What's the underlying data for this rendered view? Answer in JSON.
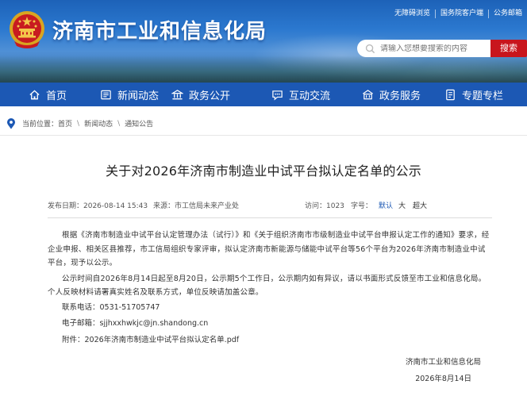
{
  "header": {
    "site_title": "济南市工业和信息化局",
    "top_links": [
      "无障碍浏览",
      "国务院客户端",
      "公务邮箱"
    ],
    "search": {
      "placeholder": "请输入您想要搜索的内容",
      "button_label": "搜索"
    },
    "colors": {
      "accent_blue": "#1c58b4",
      "search_red": "#c8151d"
    }
  },
  "nav": {
    "items": [
      {
        "label": "首页",
        "icon": "home-icon"
      },
      {
        "label": "新闻动态",
        "icon": "news-icon"
      },
      {
        "label": "政务公开",
        "icon": "building-icon"
      },
      {
        "label": "互动交流",
        "icon": "chat-icon"
      },
      {
        "label": "政务服务",
        "icon": "service-icon"
      },
      {
        "label": "专题专栏",
        "icon": "document-icon"
      }
    ]
  },
  "breadcrumb": {
    "prefix": "当前位置：",
    "items": [
      "首页",
      "新闻动态",
      "通知公告"
    ],
    "separator": "\\"
  },
  "article": {
    "title": "关于对2026年济南市制造业中试平台拟认定名单的公示",
    "meta": {
      "publish_time": "发布日期：2026-08-14 15:43",
      "source": "来源：市工信局未来产业处",
      "views": "访问：1023",
      "font_size_label": "字号：",
      "font_sizes": [
        "默认",
        "大",
        "超大"
      ]
    },
    "paragraphs": [
      "根据《济南市制造业中试平台认定管理办法（试行）》和《关于组织济南市市级制造业中试平台申报认定工作的通知》要求，经企业申报、相关区县推荐，市工信局组织专家评审，拟认定济南市新能源与储能中试平台等56个平台为2026年济南市制造业中试平台，现予以公示。",
      "公示时间自2026年8月14日起至8月20日，公示期5个工作日，公示期内如有异议，请以书面形式反馈至市工业和信息化局。个人反映材料请署真实姓名及联系方式，单位反映请加盖公章。"
    ],
    "contact_phone": "联系电话：0531-51705747",
    "contact_email": "电子邮箱：sjjhxxhwkjc@jn.shandong.cn",
    "attachment": "附件：2026年济南市制造业中试平台拟认定名单.pdf",
    "signature": {
      "org": "济南市工业和信息化局",
      "date": "2026年8月14日"
    }
  }
}
